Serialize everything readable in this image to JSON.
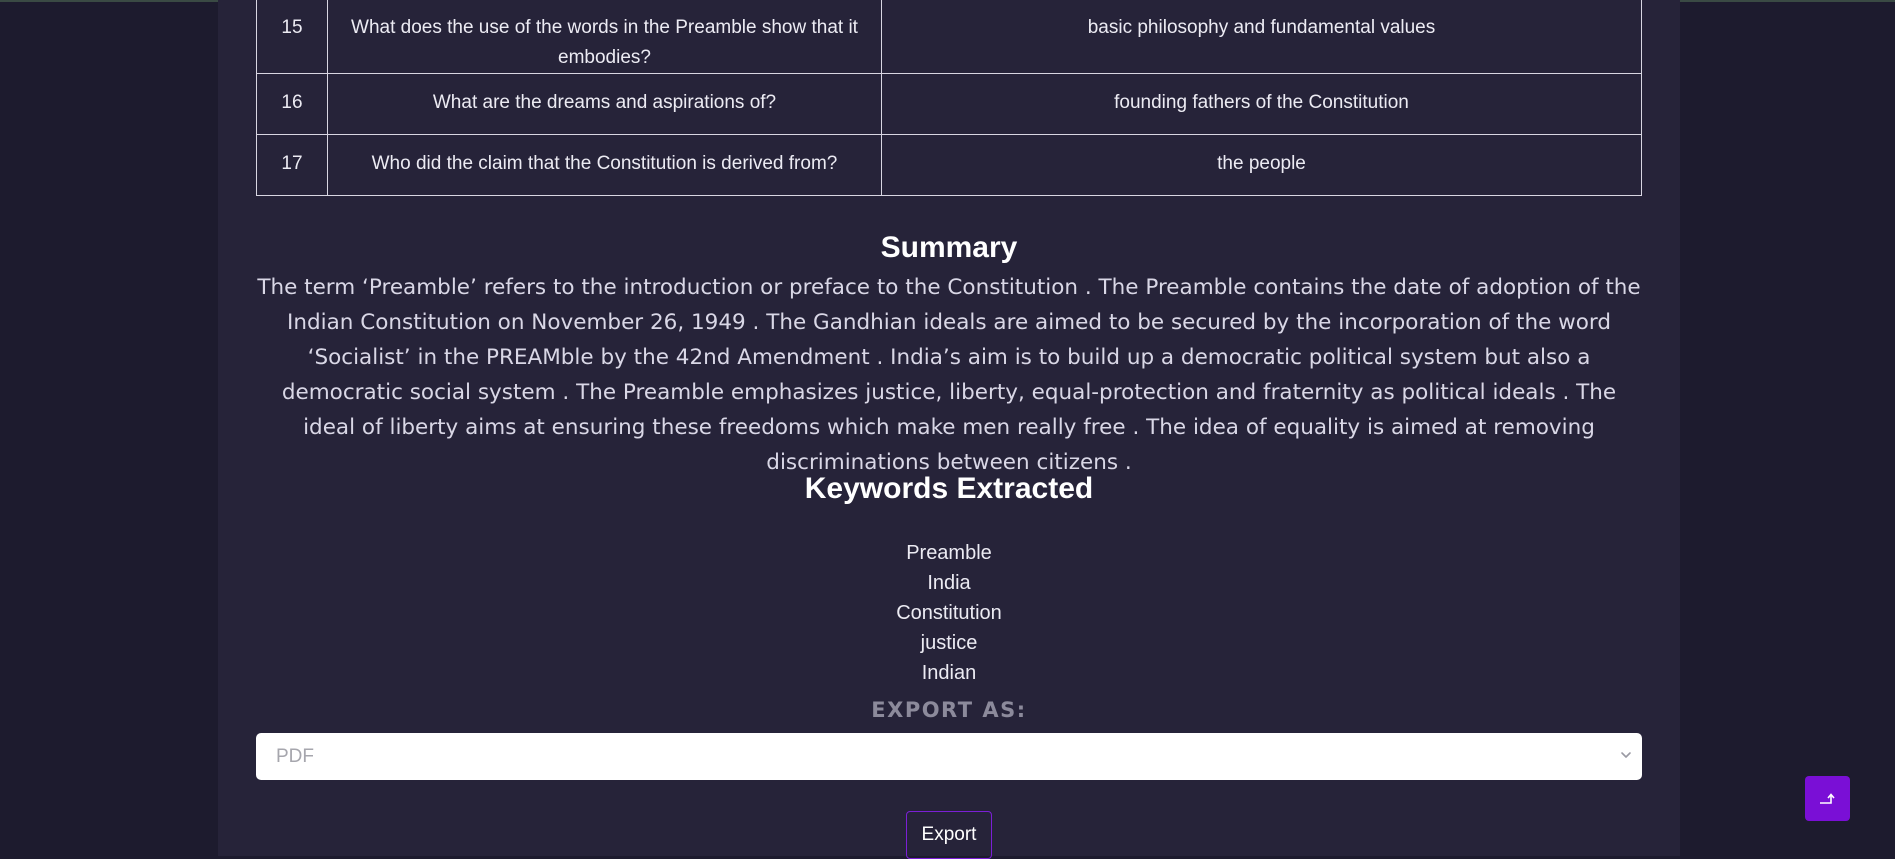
{
  "qa_table": {
    "rows": [
      {
        "num": "15",
        "question": "What does the use of the words in the Preamble show that it embodies?",
        "answer": "basic philosophy and fundamental values"
      },
      {
        "num": "16",
        "question": "What are the dreams and aspirations of?",
        "answer": "founding fathers of the Constitution"
      },
      {
        "num": "17",
        "question": "Who did the claim that the Constitution is derived from?",
        "answer": "the people"
      }
    ]
  },
  "summary": {
    "title": "Summary",
    "text": "The term ‘Preamble’ refers to the introduction or preface to the Constitution . The Preamble contains the date of adoption of the Indian Constitution on November 26, 1949 . The Gandhian ideals are aimed to be secured by the incorporation of the word ‘Socialist’ in the PREAMble by the 42nd Amendment . India’s aim is to build up a democratic political system but also a democratic social system . The Preamble emphasizes justice, liberty, equal-protection and fraternity as political ideals . The ideal of liberty aims at ensuring these freedoms which make men really free . The idea of equality is aimed at removing discriminations between citizens ."
  },
  "keywords": {
    "title": "Keywords Extracted",
    "items": [
      "Preamble",
      "India",
      "Constitution",
      "justice",
      "Indian"
    ]
  },
  "export": {
    "label": "EXPORT AS:",
    "selected": "PDF",
    "button_label": "Export"
  },
  "icons": {
    "select": "chevron-down-icon",
    "fab": "arrow-up-right-icon"
  },
  "colors": {
    "accent": "#7a0fd6",
    "background": "#1d1b2e",
    "panel": "#262339"
  }
}
